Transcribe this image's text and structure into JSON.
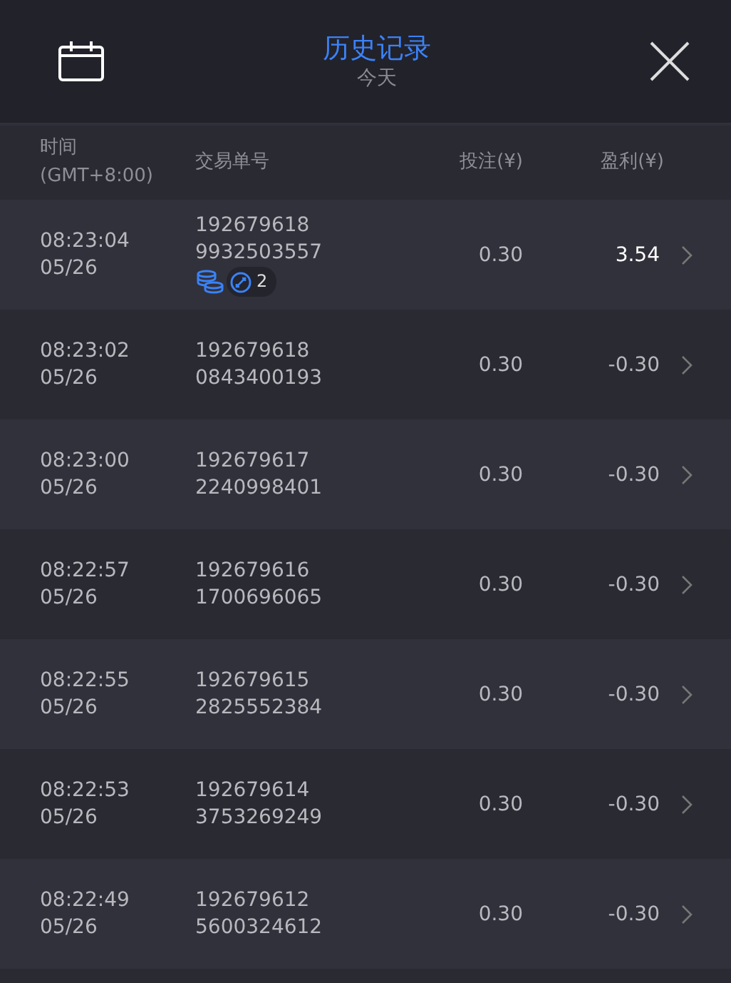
{
  "header": {
    "title": "历史记录",
    "subtitle": "今天"
  },
  "columns": [
    "时间\n(GMT+8:00)",
    "交易单号",
    "投注(¥)",
    "盈利(¥)"
  ],
  "rows": [
    {
      "time": "08:23:04",
      "date": "05/26",
      "id_1": "192679618",
      "id_2": "9932503557",
      "bet": "0.30",
      "profit": "3.54",
      "kind": "win",
      "badge_count": "2"
    },
    {
      "time": "08:23:02",
      "date": "05/26",
      "id_1": "192679618",
      "id_2": "0843400193",
      "bet": "0.30",
      "profit": "-0.30",
      "kind": "loss"
    },
    {
      "time": "08:23:00",
      "date": "05/26",
      "id_1": "192679617",
      "id_2": "2240998401",
      "bet": "0.30",
      "profit": "-0.30",
      "kind": "loss"
    },
    {
      "time": "08:22:57",
      "date": "05/26",
      "id_1": "192679616",
      "id_2": "1700696065",
      "bet": "0.30",
      "profit": "-0.30",
      "kind": "loss"
    },
    {
      "time": "08:22:55",
      "date": "05/26",
      "id_1": "192679615",
      "id_2": "2825552384",
      "bet": "0.30",
      "profit": "-0.30",
      "kind": "loss"
    },
    {
      "time": "08:22:53",
      "date": "05/26",
      "id_1": "192679614",
      "id_2": "3753269249",
      "bet": "0.30",
      "profit": "-0.30",
      "kind": "loss"
    },
    {
      "time": "08:22:49",
      "date": "05/26",
      "id_1": "192679612",
      "id_2": "5600324612",
      "bet": "0.30",
      "profit": "-0.30",
      "kind": "loss"
    }
  ]
}
